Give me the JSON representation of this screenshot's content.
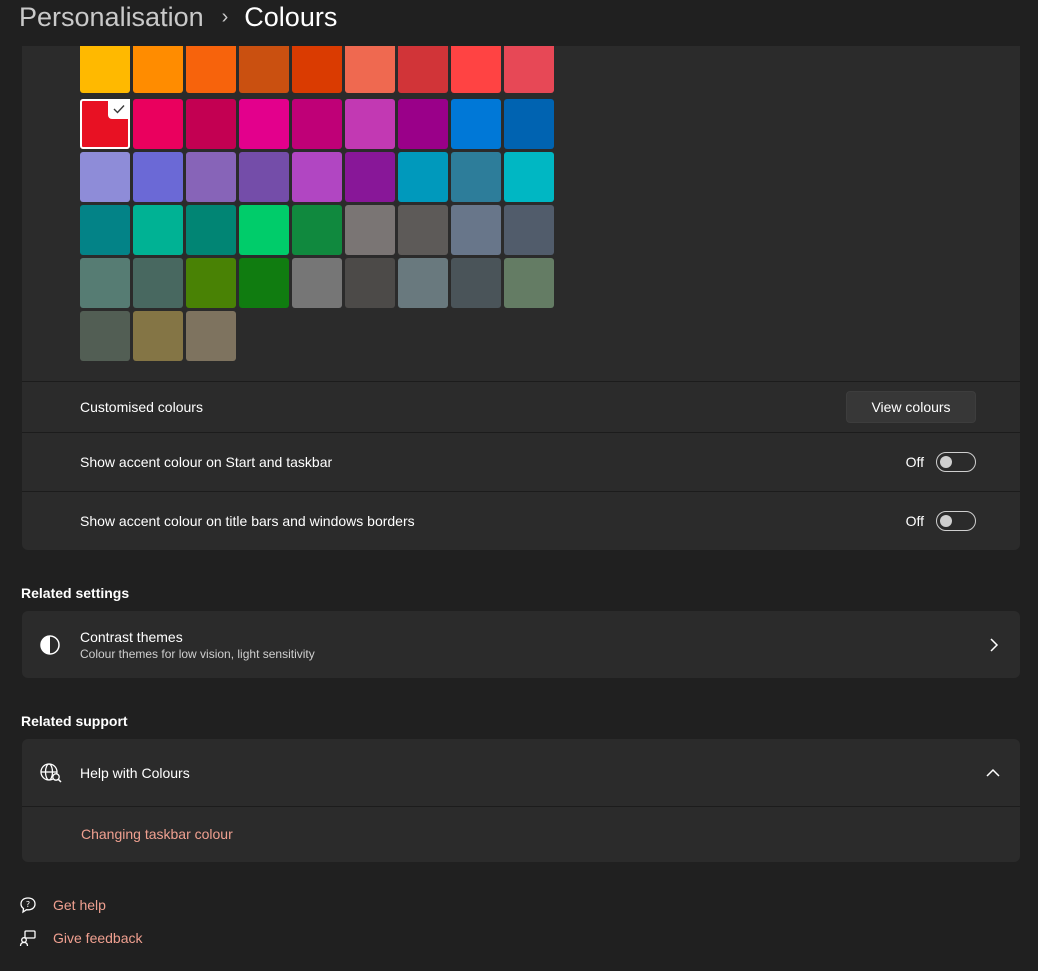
{
  "breadcrumb": {
    "parent": "Personalisation",
    "separator": "›",
    "current": "Colours"
  },
  "accent": {
    "swatches": [
      "#FFB900",
      "#FF8C00",
      "#F7630C",
      "#CA5010",
      "#DA3B01",
      "#EF6950",
      "#D13438",
      "#FF4343",
      "#E74856",
      "#E81123",
      "#EA005E",
      "#C30052",
      "#E3008C",
      "#BF0077",
      "#C239B3",
      "#9A0089",
      "#0078D7",
      "#0063B1",
      "#8E8CD8",
      "#6B69D6",
      "#8764B8",
      "#744DA9",
      "#B146C2",
      "#881798",
      "#0099BC",
      "#2D7D9A",
      "#00B7C3",
      "#038387",
      "#00B294",
      "#018574",
      "#00CC6A",
      "#10893E",
      "#7A7574",
      "#5D5A58",
      "#68768A",
      "#515C6B",
      "#567C73",
      "#486860",
      "#498205",
      "#107C10",
      "#767676",
      "#4C4A48",
      "#69797E",
      "#4A5459",
      "#647C64",
      "#525E54",
      "#847545",
      "#7E735F"
    ],
    "selected_index": 9
  },
  "settings": {
    "custom_colours_label": "Customised colours",
    "view_colours_button": "View colours",
    "start_taskbar_label": "Show accent colour on Start and taskbar",
    "start_taskbar_state": "Off",
    "title_bars_label": "Show accent colour on title bars and windows borders",
    "title_bars_state": "Off"
  },
  "related_settings": {
    "title": "Related settings",
    "contrast_title": "Contrast themes",
    "contrast_desc": "Colour themes for low vision, light sensitivity"
  },
  "related_support": {
    "title": "Related support",
    "help_title": "Help with Colours",
    "link": "Changing taskbar colour"
  },
  "footer": {
    "get_help": "Get help",
    "give_feedback": "Give feedback"
  },
  "colors": {
    "background": "#202020",
    "card": "#2b2b2b",
    "link": "#F0A090"
  },
  "icons": [
    "chevron-right-icon",
    "checkmark-icon",
    "contrast-icon",
    "globe-help-icon",
    "chevron-up-icon",
    "get-help-icon",
    "feedback-icon"
  ]
}
